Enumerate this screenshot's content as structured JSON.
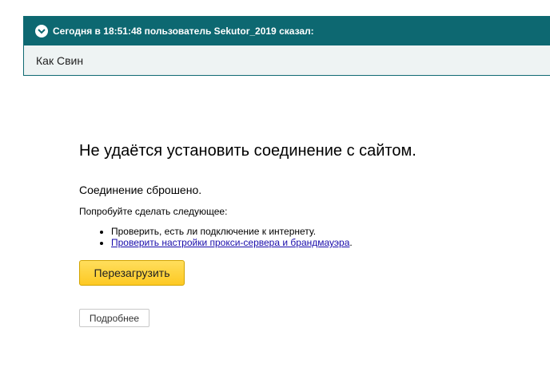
{
  "quote": {
    "header": "Сегодня в 18:51:48 пользователь Sekutor_2019 сказал:",
    "body": "Как Свин",
    "icon": "chevron-down-icon"
  },
  "error": {
    "title": "Не удаётся установить соединение с сайтом.",
    "subtitle": "Соединение сброшено.",
    "try_label": "Попробуйте сделать следующее:",
    "suggestions": [
      {
        "text": "Проверить, есть ли подключение к интернету.",
        "suffix": ""
      },
      {
        "text": "Проверить настройки прокси-сервера и брандмауэра",
        "suffix": "."
      }
    ],
    "reload_label": "Перезагрузить",
    "details_label": "Подробнее"
  },
  "colors": {
    "quote_header_bg": "#0d6871",
    "reload_button": "#fdc923",
    "link": "#1a0dab"
  }
}
